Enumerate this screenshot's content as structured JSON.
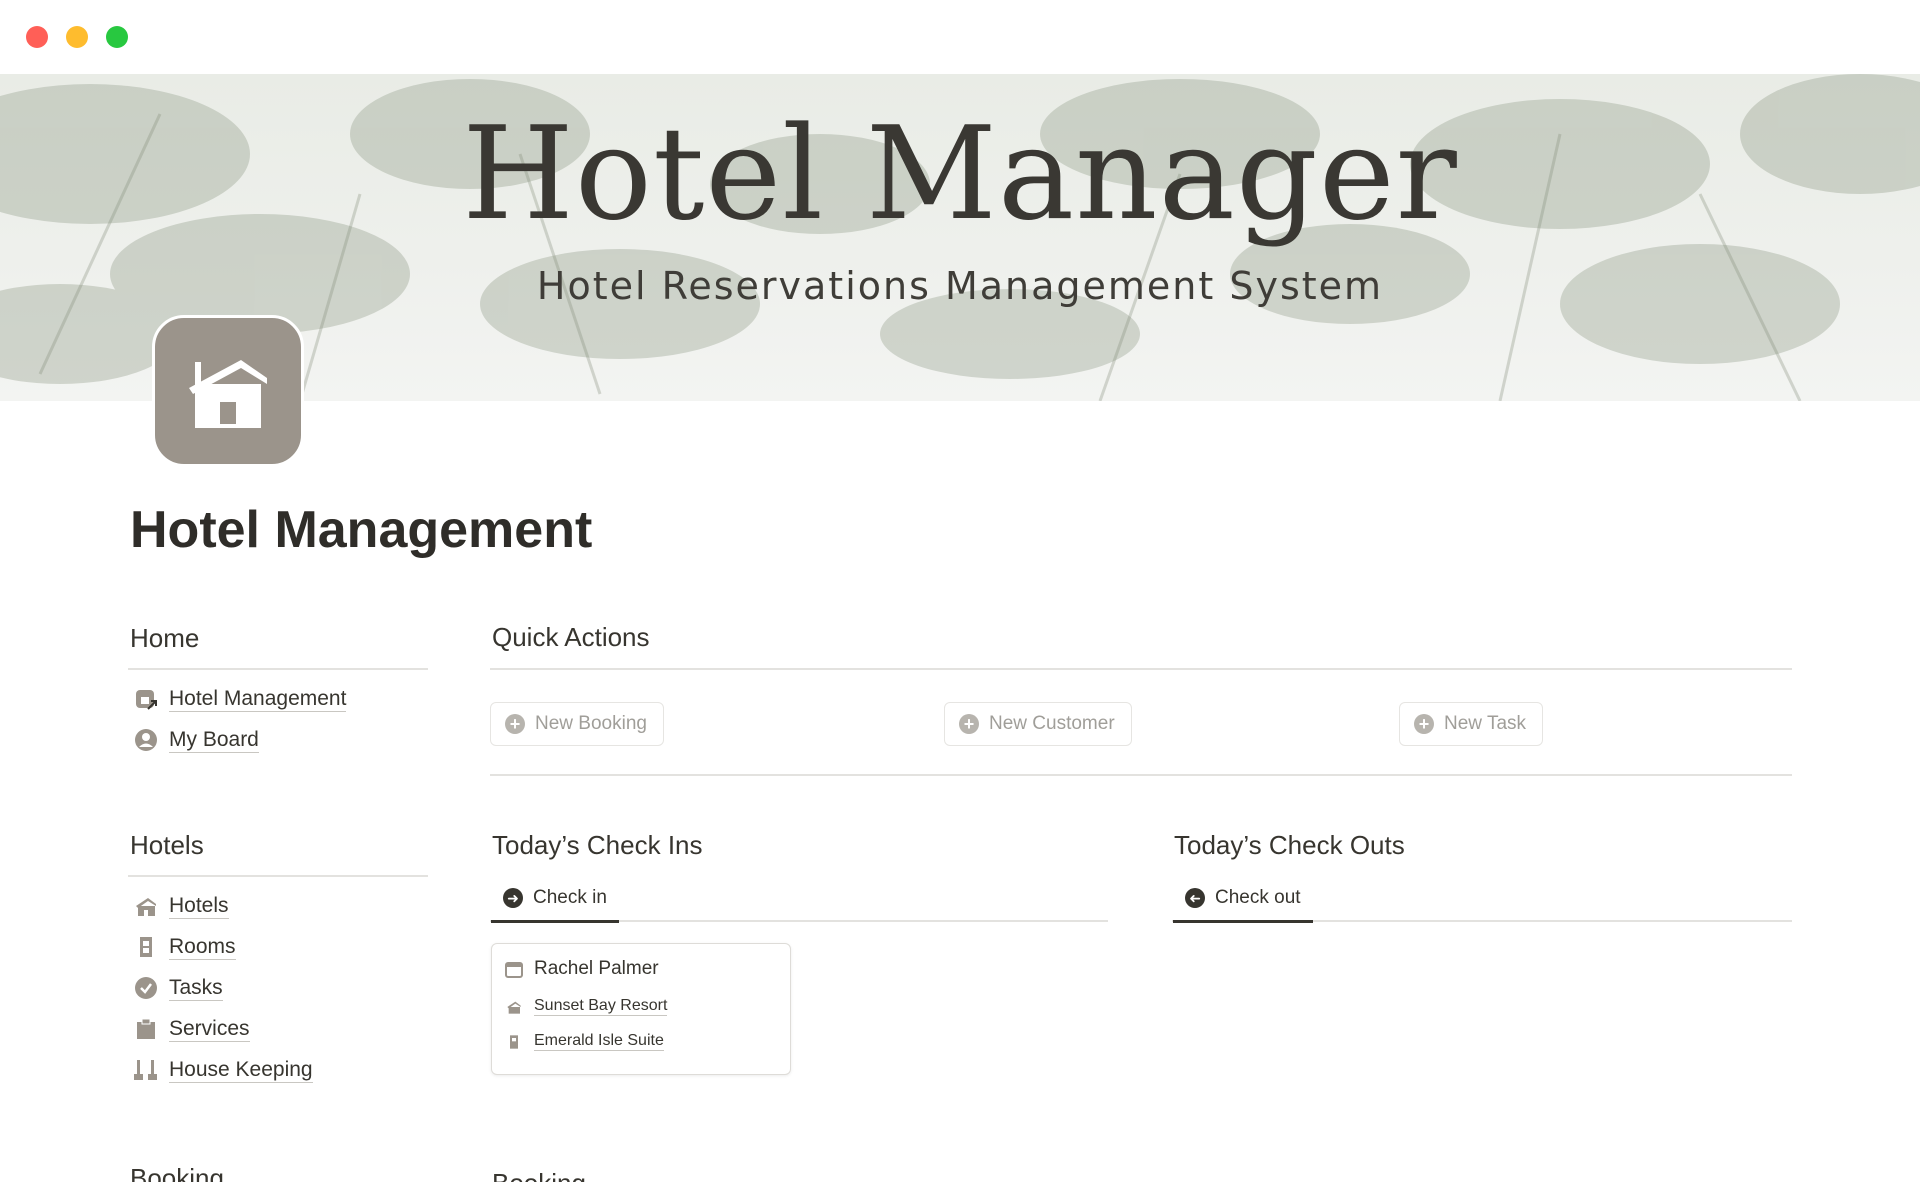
{
  "cover": {
    "title": "Hotel Manager",
    "subtitle": "Hotel Reservations Management System"
  },
  "page": {
    "title": "Hotel Management"
  },
  "sidebar": {
    "home": {
      "heading": "Home",
      "items": [
        {
          "label": "Hotel Management",
          "icon": "hotel-link-icon"
        },
        {
          "label": "My Board",
          "icon": "user-circle-icon"
        }
      ]
    },
    "hotels": {
      "heading": "Hotels",
      "items": [
        {
          "label": "Hotels",
          "icon": "hotel-icon"
        },
        {
          "label": "Rooms",
          "icon": "door-icon"
        },
        {
          "label": "Tasks",
          "icon": "check-circle-icon"
        },
        {
          "label": "Services",
          "icon": "clipboard-icon"
        },
        {
          "label": "House Keeping",
          "icon": "broom-icon"
        }
      ]
    },
    "booking_heading": "Booking"
  },
  "quick_actions": {
    "heading": "Quick Actions",
    "buttons": [
      "New Booking",
      "New Customer",
      "New Task"
    ]
  },
  "check_ins": {
    "heading": "Today’s Check Ins",
    "tab": "Check in",
    "cards": [
      {
        "name": "Rachel Palmer",
        "hotel": "Sunset Bay Resort",
        "room": "Emerald Isle Suite"
      }
    ]
  },
  "check_outs": {
    "heading": "Today’s Check Outs",
    "tab": "Check out"
  },
  "main_booking_heading": "Booking",
  "colors": {
    "text": "#37352f",
    "icon_bg": "#9b948b",
    "muted": "#a09e99",
    "close": "#ff5f57",
    "minimize": "#febc2e",
    "zoom": "#28c840"
  }
}
